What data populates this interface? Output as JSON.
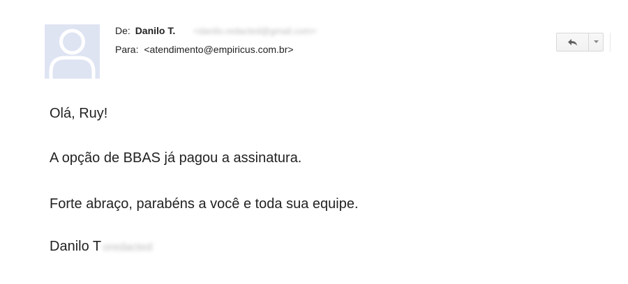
{
  "header": {
    "from_label": "De:",
    "sender_name": "Danilo T.",
    "sender_email_redacted": "<danilo.redacted@gmail.com>",
    "to_label": "Para:",
    "recipient": "<atendimento@empiricus.com.br>"
  },
  "toolbar": {
    "reply_icon": "reply-icon",
    "more_icon": "chevron-down-icon"
  },
  "message": {
    "greeting": "Olá, Ruy!",
    "line1": "A opção de BBAS já pagou a assinatura.",
    "line2": "Forte abraço, parabéns a você e toda sua equipe.",
    "signature_first": "Danilo T",
    "signature_surname_redacted": "oredacted"
  },
  "colors": {
    "avatar_bg": "#dfe4f3",
    "avatar_figure": "#ffffff",
    "text": "#222222"
  }
}
